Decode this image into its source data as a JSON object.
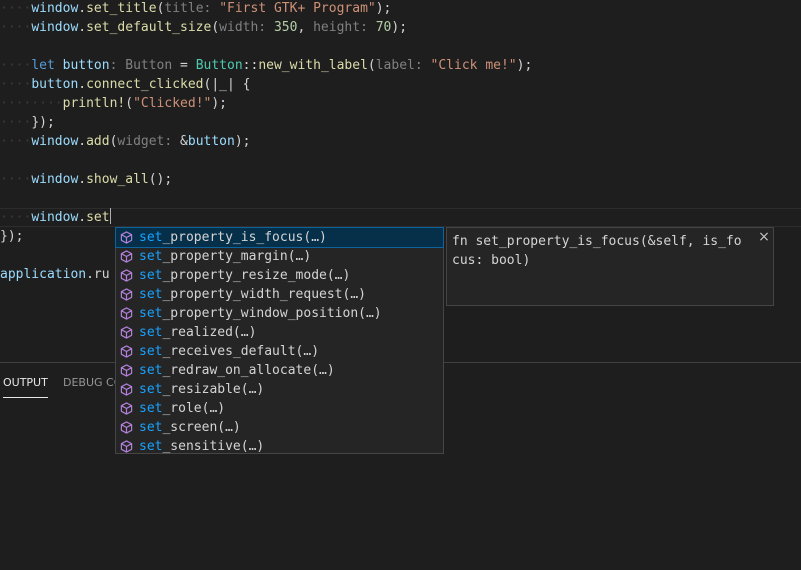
{
  "editor": {
    "lines": {
      "l1": {
        "var": "window",
        "p1": ".",
        "fn": "set_title",
        "p2": "(",
        "hint": "title: ",
        "str": "\"First GTK+ Program\"",
        "p3": ");"
      },
      "l2": {
        "var": "window",
        "p1": ".",
        "fn": "set_default_size",
        "p2": "(",
        "hint1": "width: ",
        "num1": "350",
        "p3": ", ",
        "hint2": "height: ",
        "num2": "70",
        "p4": ");"
      },
      "l3": {
        "kw": "let",
        "var": "button",
        "hint": ": Button",
        "p1": " = ",
        "ty": "Button",
        "p2": "::",
        "fn": "new_with_label",
        "p3": "(",
        "hint2": "label: ",
        "str": "\"Click me!\"",
        "p4": ");"
      },
      "l4": {
        "var": "button",
        "p1": ".",
        "fn": "connect_clicked",
        "p2": "(|_| {"
      },
      "l5": {
        "mac": "println!",
        "p1": "(",
        "str": "\"Clicked!\"",
        "p2": ");"
      },
      "l6": {
        "p1": "});"
      },
      "l7": {
        "var": "window",
        "p1": ".",
        "fn": "add",
        "p2": "(",
        "hint": "widget: ",
        "p3": "&",
        "var2": "button",
        "p4": ");"
      },
      "l8": {
        "var": "window",
        "p1": ".",
        "fn": "show_all",
        "p2": "();"
      },
      "l9": {
        "var": "window",
        "p1": ".",
        "typed": "set"
      },
      "l10": {
        "p1": "});"
      },
      "l11": {
        "var": "application",
        "p1": ".ru"
      }
    }
  },
  "suggest": {
    "match_prefix": "set",
    "items": [
      {
        "rest": "_property_is_focus(…)",
        "selected": true
      },
      {
        "rest": "_property_margin(…)"
      },
      {
        "rest": "_property_resize_mode(…)"
      },
      {
        "rest": "_property_width_request(…)"
      },
      {
        "rest": "_property_window_position(…)"
      },
      {
        "rest": "_realized(…)"
      },
      {
        "rest": "_receives_default(…)"
      },
      {
        "rest": "_redraw_on_allocate(…)"
      },
      {
        "rest": "_resizable(…)"
      },
      {
        "rest": "_role(…)"
      },
      {
        "rest": "_screen(…)"
      },
      {
        "rest": "_sensitive(…)"
      }
    ],
    "icon": "method-cube-icon",
    "icon_color": "#b180d7"
  },
  "details": {
    "signature": "fn set_property_is_focus(&self, is_focus: bool)",
    "close_label": "×"
  },
  "panel": {
    "tabs": [
      {
        "label": "OUTPUT"
      },
      {
        "label": "DEBUG CO"
      }
    ]
  },
  "colors": {
    "background": "#1e1e1e",
    "selection": "#062f4a",
    "match": "#18a3ff"
  }
}
